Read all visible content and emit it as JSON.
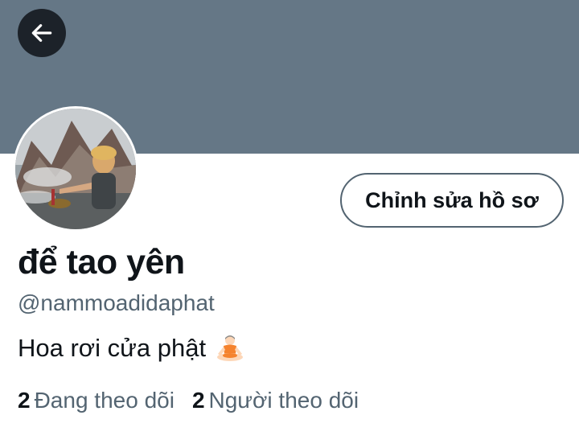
{
  "header": {
    "banner_color": "#657786",
    "back_icon": "arrow-left-icon"
  },
  "profile": {
    "display_name": "để tao yên",
    "handle": "@nammoadidaphat",
    "bio": "Hoa rơi cửa phật",
    "bio_emoji": "person-in-lotus-position-emoji",
    "edit_button_label": "Chỉnh sửa hồ sơ"
  },
  "stats": {
    "following_count": "2",
    "following_label": "Đang theo dõi",
    "followers_count": "2",
    "followers_label": "Người theo dõi"
  }
}
